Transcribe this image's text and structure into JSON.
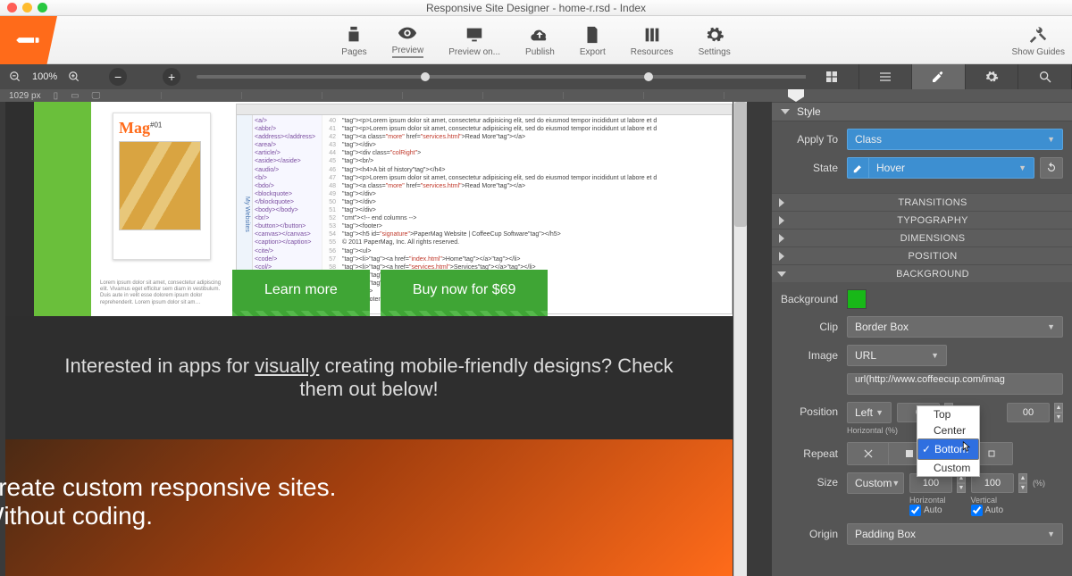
{
  "window": {
    "title": "Responsive Site Designer - home-r.rsd - Index"
  },
  "toolbar": {
    "items": [
      {
        "id": "pages",
        "label": "Pages"
      },
      {
        "id": "preview",
        "label": "Preview"
      },
      {
        "id": "preview-on",
        "label": "Preview on..."
      },
      {
        "id": "publish",
        "label": "Publish"
      },
      {
        "id": "export",
        "label": "Export"
      },
      {
        "id": "resources",
        "label": "Resources"
      },
      {
        "id": "settings",
        "label": "Settings"
      }
    ],
    "active": "preview",
    "show_guides": "Show Guides"
  },
  "zoom": {
    "value": "100%",
    "viewport_width": "1029 px"
  },
  "page": {
    "mag_title": "Mag",
    "mag_issue": "#01",
    "ipsum": "Lorem ipsum dolor sit amet, consectetur adipiscing elit. Vivamus eget efficitur sem diam in vestibulum. Duis aute in velit esse dolorem ipsum dolor reprehenderit. Lorem ipsum dolor sit am…",
    "learn_more": "Learn more",
    "buy_now": "Buy now for $69",
    "midline_a": "Interested in apps for ",
    "midline_u": "visually",
    "midline_b": " creating mobile-friendly designs? Check them out below!",
    "hero_line1": "Create custom responsive sites.",
    "hero_line2": "Without coding.",
    "code_sample": "<p>Lorem ipsum dolor sit amet, consectetur adipisicing elit, sed do eiusmod tempor incididunt ut labore et d\\n<p>Lorem ipsum dolor sit amet, consectetur adipisicing elit, sed do eiusmod tempor incididunt ut labore et d\\n<a class=\"more\" href=\"services.html\">Read More</a>\\n</div>\\n<div class=\"colRight\">\\n<br/>\\n<h4>A bit of history</h4>\\n<p>Lorem ipsum dolor sit amet, consectetur adipisicing elit, sed do eiusmod tempor incididunt ut labore et d\\n<a class=\"more\" href=\"services.html\">Read More</a>\\n</div>\\n</div>\\n</div>\\n<!-- end columns -->\\n<footer>\\n<h5 id=\"signature\">PaperMag Website | CoffeeCup Software</h5>\\n&copy; 2011 PaperMag, Inc. All rights reserved.\\n<ul>\\n<li><a href=\"index.html\">Home</a></li>\\n<li><a href=\"services.html\">Services</a></li>\\n<li><a href=\"about.html\">About</a></li>\\n<li><a href=\"contact.html\">Contact</a></li>\\n</ul>\\n</footer>"
  },
  "inspector": {
    "style_section": "Style",
    "apply_to": {
      "label": "Apply To",
      "value": "Class"
    },
    "state": {
      "label": "State",
      "value": "Hover"
    },
    "accordion": [
      "TRANSITIONS",
      "TYPOGRAPHY",
      "DIMENSIONS",
      "POSITION",
      "BACKGROUND"
    ],
    "background": {
      "title": "Background",
      "label_bg": "Background",
      "color": "#18b818",
      "clip": {
        "label": "Clip",
        "value": "Border Box"
      },
      "image": {
        "label": "Image",
        "mode": "URL",
        "url": "url(http://www.coffeecup.com/imag"
      },
      "position": {
        "label": "Position",
        "horizontal_anchor": "Left",
        "horizontal_value": "0",
        "horizontal_unit": "Horizontal (%)",
        "vertical_value": "00",
        "dropdown_options": [
          "Top",
          "Center",
          "Bottom",
          "Custom"
        ],
        "dropdown_selected": "Bottom"
      },
      "repeat": {
        "label": "Repeat",
        "selected_index": 2
      },
      "size": {
        "label": "Size",
        "mode": "Custom",
        "h_value": "100",
        "v_value": "100",
        "unit": "(%)",
        "h_label": "Horizontal",
        "v_label": "Vertical",
        "h_auto": true,
        "v_auto": true,
        "auto_label": "Auto"
      },
      "origin": {
        "label": "Origin",
        "value": "Padding Box"
      }
    }
  }
}
